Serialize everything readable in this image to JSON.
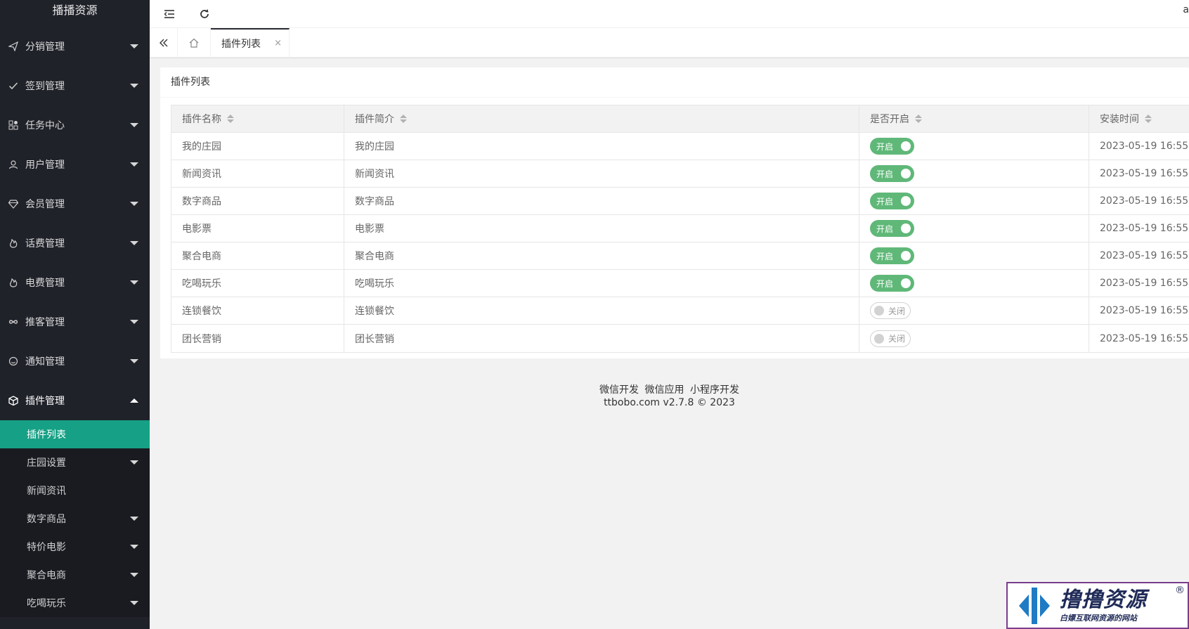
{
  "app": {
    "logo": "播播资源"
  },
  "sidebar": {
    "menu": [
      {
        "label": "分销管理",
        "icon": "send-icon",
        "expanded": false
      },
      {
        "label": "签到管理",
        "icon": "check-icon",
        "expanded": false
      },
      {
        "label": "任务中心",
        "icon": "apps-icon",
        "expanded": false
      },
      {
        "label": "用户管理",
        "icon": "user-icon",
        "expanded": false
      },
      {
        "label": "会员管理",
        "icon": "diamond-icon",
        "expanded": false
      },
      {
        "label": "话费管理",
        "icon": "fire-icon",
        "expanded": false
      },
      {
        "label": "电费管理",
        "icon": "fire-icon",
        "expanded": false
      },
      {
        "label": "推客管理",
        "icon": "infinity-icon",
        "expanded": false
      },
      {
        "label": "通知管理",
        "icon": "smile-icon",
        "expanded": false
      },
      {
        "label": "插件管理",
        "icon": "cube-icon",
        "expanded": true
      }
    ],
    "submenu": [
      {
        "label": "插件列表",
        "active": true,
        "has_children": false
      },
      {
        "label": "庄园设置",
        "active": false,
        "has_children": true
      },
      {
        "label": "新闻资讯",
        "active": false,
        "has_children": false
      },
      {
        "label": "数字商品",
        "active": false,
        "has_children": true
      },
      {
        "label": "特价电影",
        "active": false,
        "has_children": true
      },
      {
        "label": "聚合电商",
        "active": false,
        "has_children": true
      },
      {
        "label": "吃喝玩乐",
        "active": false,
        "has_children": true
      }
    ],
    "accent_color": "#16a085"
  },
  "header": {
    "user_initial": "a"
  },
  "tabs": {
    "items": [
      {
        "label": "插件列表",
        "closable": true,
        "close_symbol": "×"
      }
    ]
  },
  "card": {
    "title": "插件列表",
    "columns": [
      "插件名称",
      "插件简介",
      "是否开启",
      "安装时间"
    ],
    "rows": [
      {
        "name": "我的庄园",
        "desc": "我的庄园",
        "enabled": true,
        "status": "开启",
        "time": "2023-05-19 16:55"
      },
      {
        "name": "新闻资讯",
        "desc": "新闻资讯",
        "enabled": true,
        "status": "开启",
        "time": "2023-05-19 16:55"
      },
      {
        "name": "数字商品",
        "desc": "数字商品",
        "enabled": true,
        "status": "开启",
        "time": "2023-05-19 16:55"
      },
      {
        "name": "电影票",
        "desc": "电影票",
        "enabled": true,
        "status": "开启",
        "time": "2023-05-19 16:55"
      },
      {
        "name": "聚合电商",
        "desc": "聚合电商",
        "enabled": true,
        "status": "开启",
        "time": "2023-05-19 16:55"
      },
      {
        "name": "吃喝玩乐",
        "desc": "吃喝玩乐",
        "enabled": true,
        "status": "开启",
        "time": "2023-05-19 16:55"
      },
      {
        "name": "连锁餐饮",
        "desc": "连锁餐饮",
        "enabled": false,
        "status": "关闭",
        "time": "2023-05-19 16:55"
      },
      {
        "name": "团长营销",
        "desc": "团长营销",
        "enabled": false,
        "status": "关闭",
        "time": "2023-05-19 16:55"
      }
    ],
    "switch_on_color": "#5fb878"
  },
  "footer": {
    "links": [
      "微信开发",
      "微信应用",
      "小程序开发"
    ],
    "copyright": "ttbobo.com v2.7.8 © 2023"
  },
  "watermark": {
    "title": "撸撸资源",
    "subtitle": "白嫖互联网资源的网站",
    "reg": "®"
  }
}
